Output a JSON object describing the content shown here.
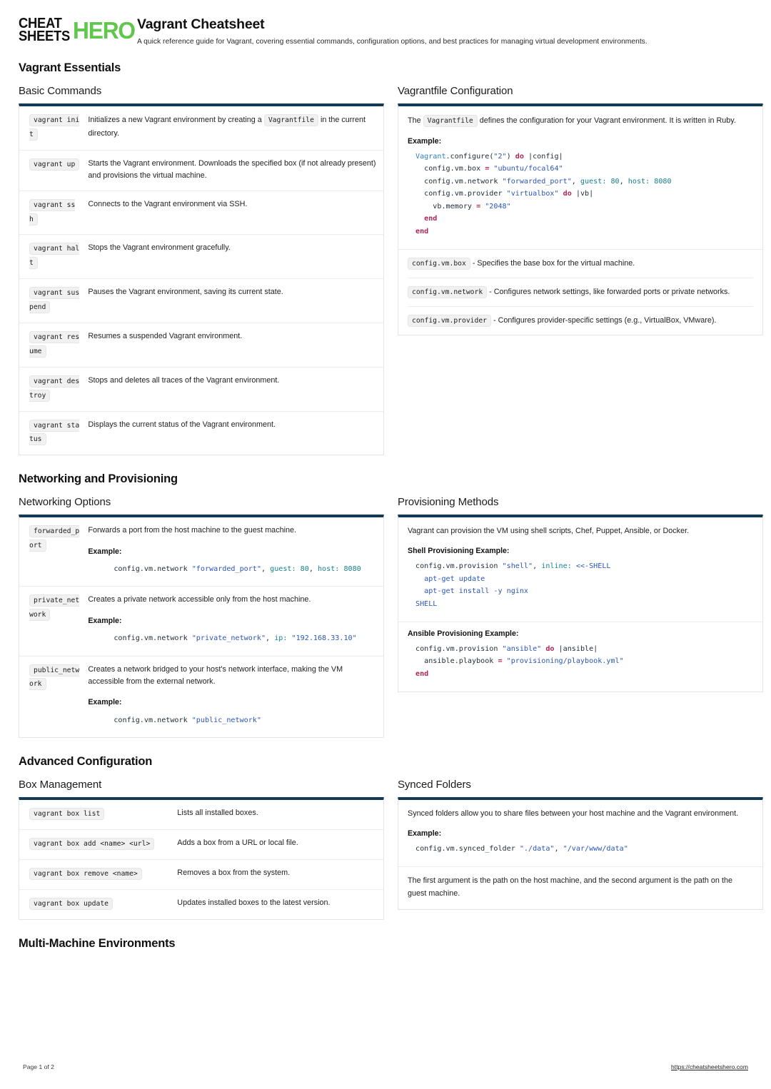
{
  "brand": {
    "line1": "CHEAT",
    "line2": "SHEETS",
    "hero": "HERO",
    "accent_green": "#5fc74b"
  },
  "header": {
    "title": "Vagrant Cheatsheet",
    "subtitle": "A quick reference guide for Vagrant, covering essential commands, configuration options, and best practices for managing virtual development environments."
  },
  "theme": {
    "panel_top_border": "#123a56",
    "chip_bg": "#f1f1f1",
    "text": "#222222"
  },
  "sections": {
    "essentials": "Vagrant Essentials",
    "networking": "Networking and Provisioning",
    "advanced": "Advanced Configuration",
    "multimachine": "Multi-Machine Environments"
  },
  "basic_commands": {
    "heading": "Basic Commands",
    "rows": [
      {
        "cmd": "vagrant init",
        "desc_pre": "Initializes a new Vagrant environment by creating a ",
        "desc_code": "Vagrantfile",
        "desc_post": " in the current directory."
      },
      {
        "cmd": "vagrant up",
        "desc": "Starts the Vagrant environment. Downloads the specified box (if not already present) and provisions the virtual machine."
      },
      {
        "cmd": "vagrant ssh",
        "desc": "Connects to the Vagrant environment via SSH."
      },
      {
        "cmd": "vagrant halt",
        "desc": "Stops the Vagrant environment gracefully."
      },
      {
        "cmd": "vagrant suspend",
        "desc": "Pauses the Vagrant environment, saving its current state."
      },
      {
        "cmd": "vagrant resume",
        "desc": "Resumes a suspended Vagrant environment."
      },
      {
        "cmd": "vagrant destroy",
        "desc": "Stops and deletes all traces of the Vagrant environment."
      },
      {
        "cmd": "vagrant status",
        "desc": "Displays the current status of the Vagrant environment."
      }
    ]
  },
  "vagrantfile": {
    "heading": "Vagrantfile Configuration",
    "intro_pre": "The ",
    "intro_code": "Vagrantfile",
    "intro_post": " defines the configuration for your Vagrant environment. It is written in Ruby.",
    "example_label": "Example:",
    "defs": [
      {
        "code": "config.vm.box",
        "text": " - Specifies the base box for the virtual machine."
      },
      {
        "code": "config.vm.network",
        "text": " - Configures network settings, like forwarded ports or private networks."
      },
      {
        "code": "config.vm.provider",
        "text": " - Configures provider-specific settings (e.g., VirtualBox, VMware)."
      }
    ]
  },
  "networking": {
    "heading": "Networking Options",
    "rows": [
      {
        "cmd": "forwarded_port",
        "desc": "Forwards a port from the host machine to the guest machine.",
        "example_label": "Example:",
        "code": "config.vm.network \"forwarded_port\", guest: 80, host: 8080"
      },
      {
        "cmd": "private_network",
        "desc": "Creates a private network accessible only from the host machine.",
        "example_label": "Example:",
        "code": "config.vm.network \"private_network\", ip: \"192.168.33.10\""
      },
      {
        "cmd": "public_network",
        "desc": "Creates a network bridged to your host's network interface, making the VM accessible from the external network.",
        "example_label": "Example:",
        "code": "config.vm.network \"public_network\""
      }
    ]
  },
  "provisioning": {
    "heading": "Provisioning Methods",
    "intro": "Vagrant can provision the VM using shell scripts, Chef, Puppet, Ansible, or Docker.",
    "shell_label": "Shell Provisioning Example:",
    "ansible_label": "Ansible Provisioning Example:"
  },
  "box_management": {
    "heading": "Box Management",
    "rows": [
      {
        "cmd": "vagrant box list",
        "desc": "Lists all installed boxes."
      },
      {
        "cmd": "vagrant box add <name> <url>",
        "desc": "Adds a box from a URL or local file."
      },
      {
        "cmd": "vagrant box remove <name>",
        "desc": "Removes a box from the system."
      },
      {
        "cmd": "vagrant box update",
        "desc": "Updates installed boxes to the latest version."
      }
    ]
  },
  "synced_folders": {
    "heading": "Synced Folders",
    "intro": "Synced folders allow you to share files between your host machine and the Vagrant environment.",
    "example_label": "Example:",
    "note": "The first argument is the path on the host machine, and the second argument is the path on the guest machine."
  },
  "footer": {
    "page": "Page 1 of 2",
    "url": "https://cheatsheetshero.com"
  }
}
